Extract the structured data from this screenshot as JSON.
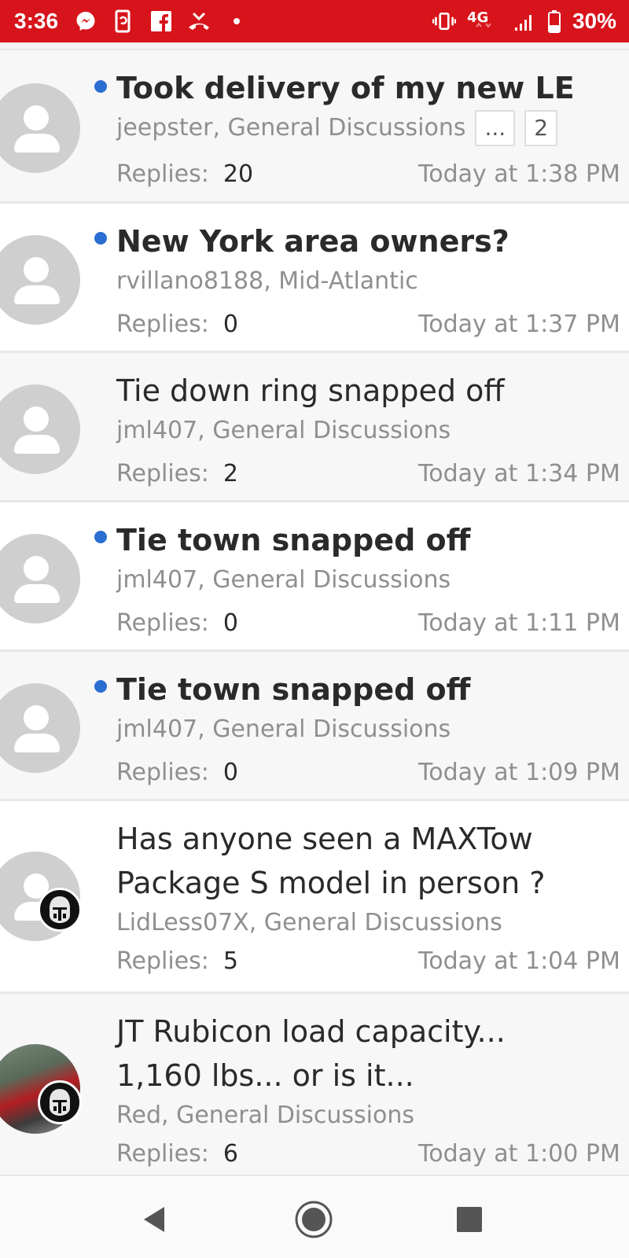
{
  "status_bar": {
    "time": "3:36",
    "left_icons": [
      "messenger-icon",
      "phone-sync-icon",
      "facebook-icon",
      "missed-call-icon",
      "dot-icon"
    ],
    "right_icons": [
      "vibrate-icon",
      "4g-lte-icon",
      "signal-icon",
      "battery-icon"
    ],
    "network": "4G",
    "battery": "30%",
    "background": "#d7141b"
  },
  "threads": [
    {
      "title": "Took delivery of my new LE",
      "unread": true,
      "author_forum": "jeepster, General Discussions",
      "pages": [
        "...",
        "2"
      ],
      "replies_label": "Replies:",
      "replies": "20",
      "date": "Today at 1:38 PM"
    },
    {
      "title": "New York area owners?",
      "unread": true,
      "author_forum": "rvillano8188, Mid-Atlantic",
      "replies_label": "Replies:",
      "replies": "0",
      "date": "Today at 1:37 PM"
    },
    {
      "title": "Tie down ring snapped off",
      "unread": false,
      "author_forum": "jml407, General Discussions",
      "replies_label": "Replies:",
      "replies": "2",
      "date": "Today at 1:34 PM"
    },
    {
      "title": "Tie town snapped off",
      "unread": true,
      "author_forum": "jml407, General Discussions",
      "replies_label": "Replies:",
      "replies": "0",
      "date": "Today at 1:11 PM"
    },
    {
      "title": "Tie town snapped off",
      "unread": true,
      "author_forum": "jml407, General Discussions",
      "replies_label": "Replies:",
      "replies": "0",
      "date": "Today at 1:09 PM"
    },
    {
      "title": "Has anyone seen a MAXTow Package S model in person ?",
      "unread": false,
      "author_forum": "LidLess07X, General Discussions",
      "replies_label": "Replies:",
      "replies": "5",
      "date": "Today at 1:04 PM"
    },
    {
      "title": "JT Rubicon load capacity... 1,160 lbs... or is it...",
      "unread": false,
      "author_forum": "Red, General Discussions",
      "replies_label": "Replies:",
      "replies": "6",
      "date": "Today at 1:00 PM"
    }
  ],
  "nav_bar": {
    "icons": [
      "back-icon",
      "home-icon",
      "recents-icon"
    ]
  },
  "colors": {
    "unread_dot": "#2b6ed1",
    "title_text": "#2a2a2a",
    "meta_text": "#8f8f8f"
  }
}
